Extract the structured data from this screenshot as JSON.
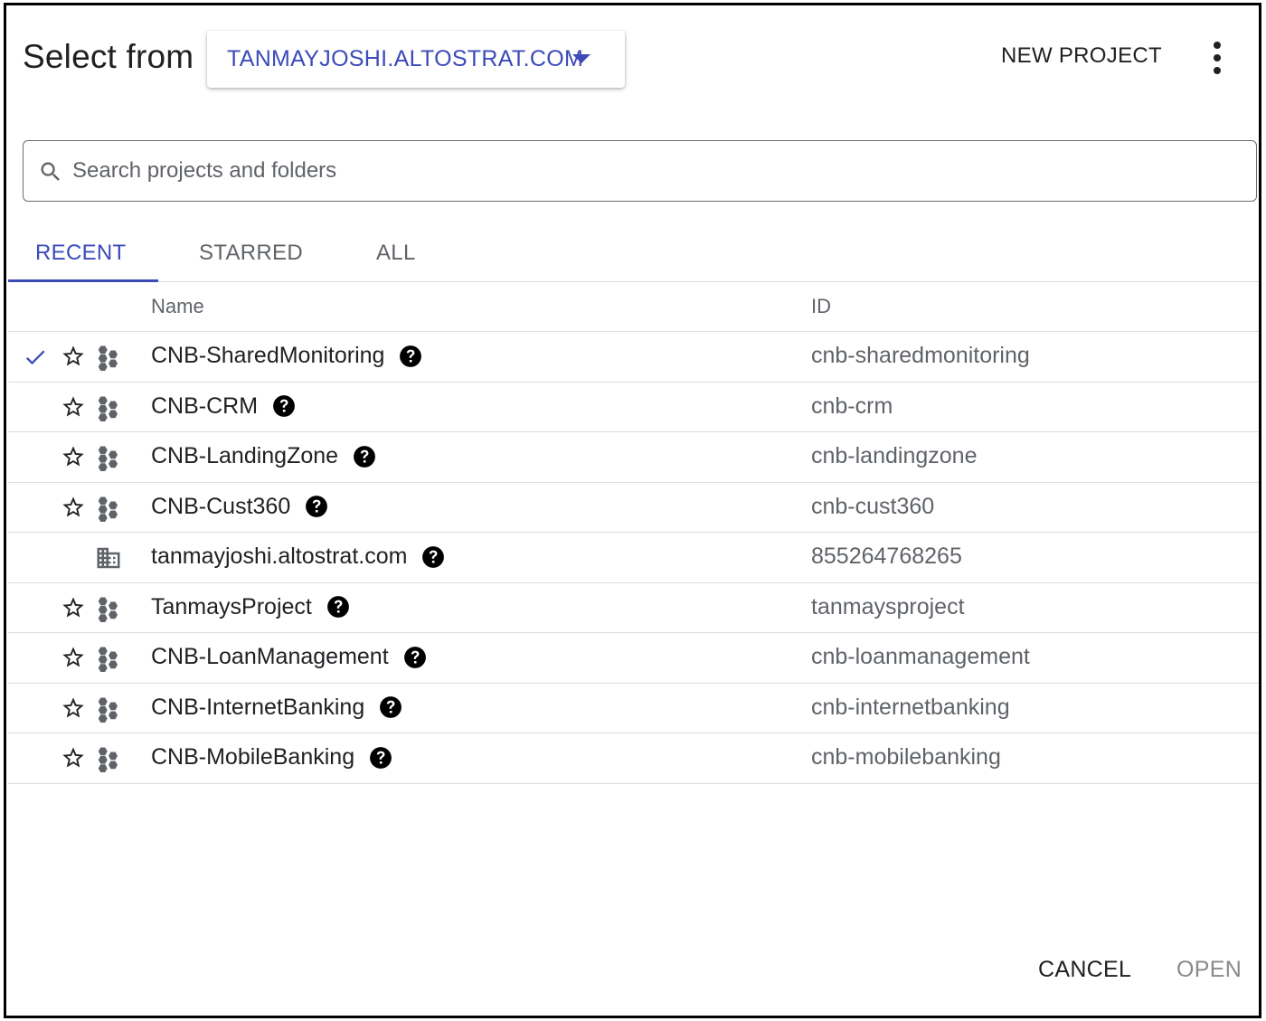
{
  "header": {
    "title": "Select from",
    "org_name": "TANMAYJOSHI.ALTOSTRAT.COM",
    "new_project_label": "NEW PROJECT",
    "more_icon": "more-vert-icon"
  },
  "search": {
    "placeholder": "Search projects and folders",
    "value": ""
  },
  "tabs": [
    {
      "label": "RECENT",
      "active": true
    },
    {
      "label": "STARRED",
      "active": false
    },
    {
      "label": "ALL",
      "active": false
    }
  ],
  "columns": {
    "name": "Name",
    "id": "ID"
  },
  "rows": [
    {
      "name": "CNB-SharedMonitoring",
      "id": "cnb-sharedmonitoring",
      "type": "project",
      "selected": true
    },
    {
      "name": "CNB-CRM",
      "id": "cnb-crm",
      "type": "project",
      "selected": false
    },
    {
      "name": "CNB-LandingZone",
      "id": "cnb-landingzone",
      "type": "project",
      "selected": false
    },
    {
      "name": "CNB-Cust360",
      "id": "cnb-cust360",
      "type": "project",
      "selected": false
    },
    {
      "name": "tanmayjoshi.altostrat.com",
      "id": "855264768265",
      "type": "organization",
      "selected": false
    },
    {
      "name": "TanmaysProject",
      "id": "tanmaysproject",
      "type": "project",
      "selected": false
    },
    {
      "name": "CNB-LoanManagement",
      "id": "cnb-loanmanagement",
      "type": "project",
      "selected": false
    },
    {
      "name": "CNB-InternetBanking",
      "id": "cnb-internetbanking",
      "type": "project",
      "selected": false
    },
    {
      "name": "CNB-MobileBanking",
      "id": "cnb-mobilebanking",
      "type": "project",
      "selected": false
    }
  ],
  "footer": {
    "cancel_label": "CANCEL",
    "open_label": "OPEN"
  },
  "colors": {
    "accent": "#3c4bb8",
    "text_primary": "#202124",
    "text_secondary": "#5f6368",
    "disabled": "#8a8a8a",
    "divider": "#dadce0"
  }
}
